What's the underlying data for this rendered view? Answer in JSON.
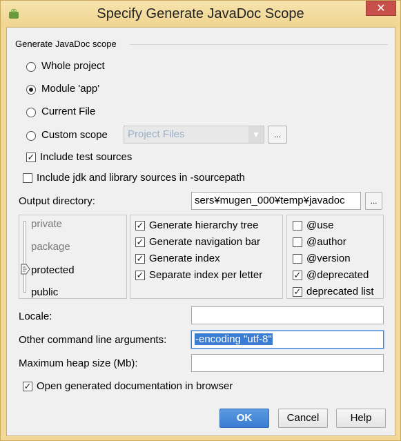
{
  "window": {
    "title": "Specify Generate JavaDoc Scope",
    "close_glyph": "✕"
  },
  "scope": {
    "group_title": "Generate JavaDoc scope",
    "options": [
      {
        "label": "Whole project",
        "selected": false
      },
      {
        "label": "Module 'app'",
        "selected": true
      },
      {
        "label": "Current File",
        "selected": false
      },
      {
        "label": "Custom scope",
        "selected": false
      }
    ],
    "custom_scope_value": "Project Files",
    "browse_label": "...",
    "include_test_sources": {
      "label": "Include test sources",
      "checked": true
    },
    "include_jdk_sources": {
      "label": "Include jdk and library sources in -sourcepath",
      "checked": false
    }
  },
  "output": {
    "label": "Output directory:",
    "value": "sers¥mugen_000¥temp¥javadoc",
    "browse_label": "..."
  },
  "visibility": {
    "levels": [
      "private",
      "package",
      "protected",
      "public"
    ],
    "selected": "protected"
  },
  "generate_options": [
    {
      "label": "Generate hierarchy tree",
      "checked": true
    },
    {
      "label": "Generate navigation bar",
      "checked": true
    },
    {
      "label": "Generate index",
      "checked": true
    },
    {
      "label": "Separate index per letter",
      "checked": true
    }
  ],
  "tag_options": [
    {
      "label": "@use",
      "checked": false
    },
    {
      "label": "@author",
      "checked": false
    },
    {
      "label": "@version",
      "checked": false
    },
    {
      "label": "@deprecated",
      "checked": true
    },
    {
      "label": "deprecated list",
      "checked": true
    }
  ],
  "locale": {
    "label": "Locale:",
    "value": ""
  },
  "other_args": {
    "label": "Other command line arguments:",
    "value": "-encoding \"utf-8\""
  },
  "max_heap": {
    "label": "Maximum heap size (Mb):",
    "value": ""
  },
  "open_in_browser": {
    "label": "Open generated documentation in browser",
    "checked": true
  },
  "buttons": {
    "ok": "OK",
    "cancel": "Cancel",
    "help": "Help"
  },
  "colors": {
    "primary_button": "#3a7dd2",
    "title_bar": "#f2d99a",
    "close_button": "#c7504a"
  }
}
